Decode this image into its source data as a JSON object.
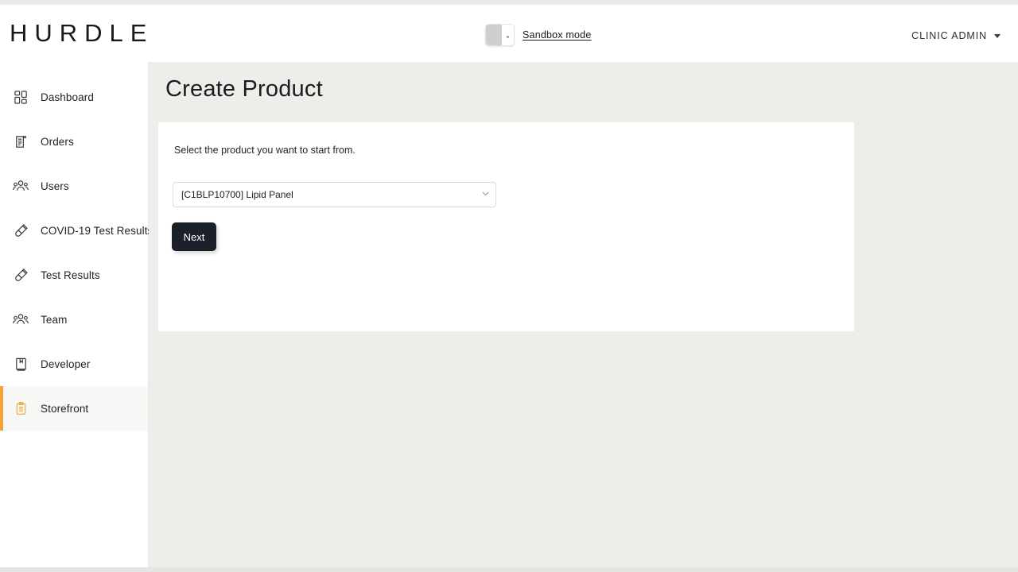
{
  "chrome": {
    "top_strip": "",
    "bottom_strip": ""
  },
  "header": {
    "logo": "HURDLE",
    "sandbox": {
      "label": "Sandbox mode",
      "toggle_state": "off",
      "toggle_icon": "toggle-switch-icon"
    },
    "user_menu": {
      "label": "CLINIC ADMIN",
      "caret_icon": "chevron-down-icon"
    }
  },
  "sidebar": {
    "items": [
      {
        "label": "Dashboard",
        "icon": "grid-dashboard-icon",
        "active": false
      },
      {
        "label": "Orders",
        "icon": "receipt-document-icon",
        "active": false
      },
      {
        "label": "Users",
        "icon": "people-group-icon",
        "active": false
      },
      {
        "label": "COVID-19 Test Results",
        "icon": "test-tube-icon",
        "active": false
      },
      {
        "label": "Test Results",
        "icon": "test-tube-icon",
        "active": false
      },
      {
        "label": "Team",
        "icon": "people-group-icon",
        "active": false
      },
      {
        "label": "Developer",
        "icon": "book-icon",
        "active": false
      },
      {
        "label": "Storefront",
        "icon": "clipboard-icon",
        "active": true
      }
    ]
  },
  "main": {
    "page_title": "Create Product",
    "card": {
      "help_text": "Select the product you want to start from.",
      "product_select": {
        "value": "[C1BLP10700] Lipid Panel",
        "chevron_icon": "chevron-down-icon"
      },
      "next_label": "Next"
    }
  },
  "colors": {
    "accent_orange": "#f0a33c",
    "page_background": "#ededea",
    "card_background": "#ffffff",
    "button_dark": "#1c2028",
    "text_primary": "#1a1c1f"
  }
}
